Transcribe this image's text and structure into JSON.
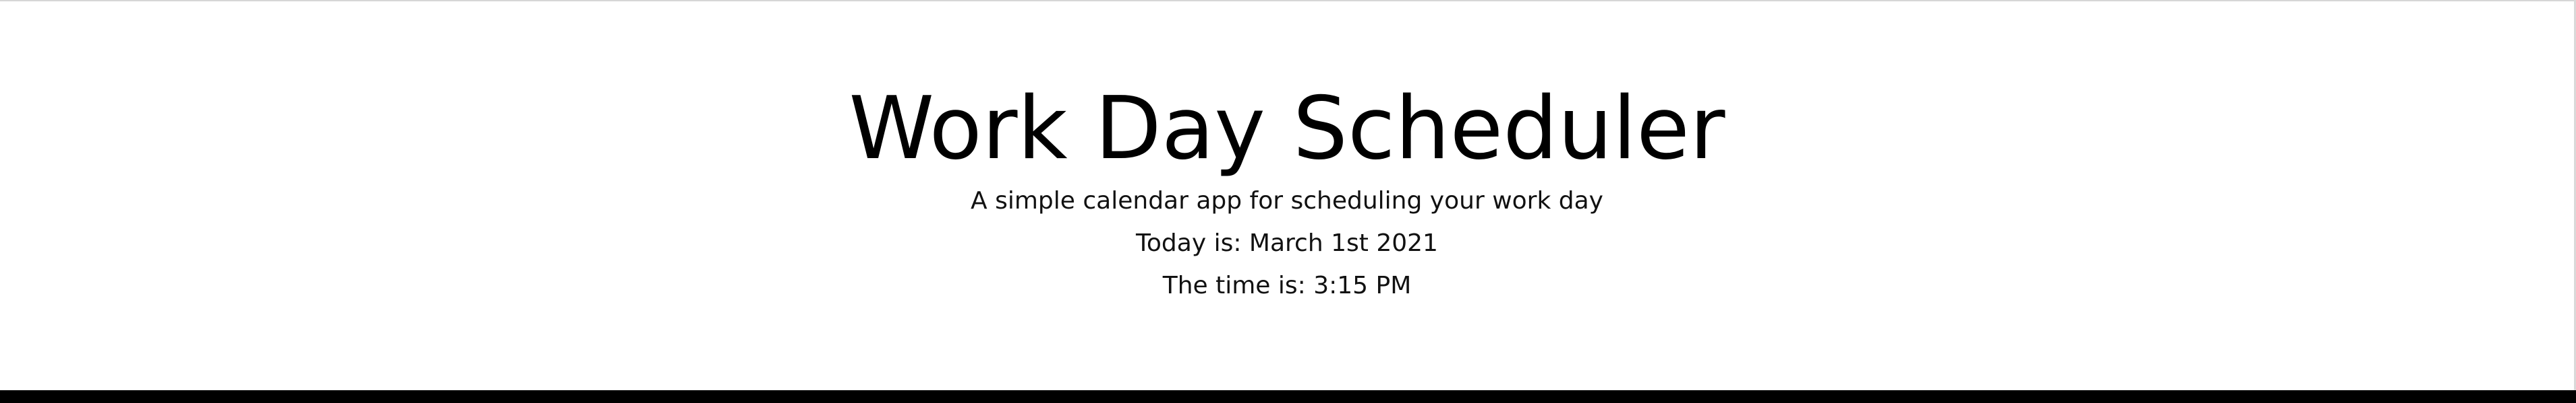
{
  "header": {
    "title": "Work Day Scheduler",
    "subtitle": "A simple calendar app for scheduling your work day",
    "today": "Today is: March 1st 2021",
    "time": "The time is: 3:15 PM"
  },
  "colors": {
    "background": "#ffffff",
    "text": "#000000",
    "border": "#000000"
  }
}
